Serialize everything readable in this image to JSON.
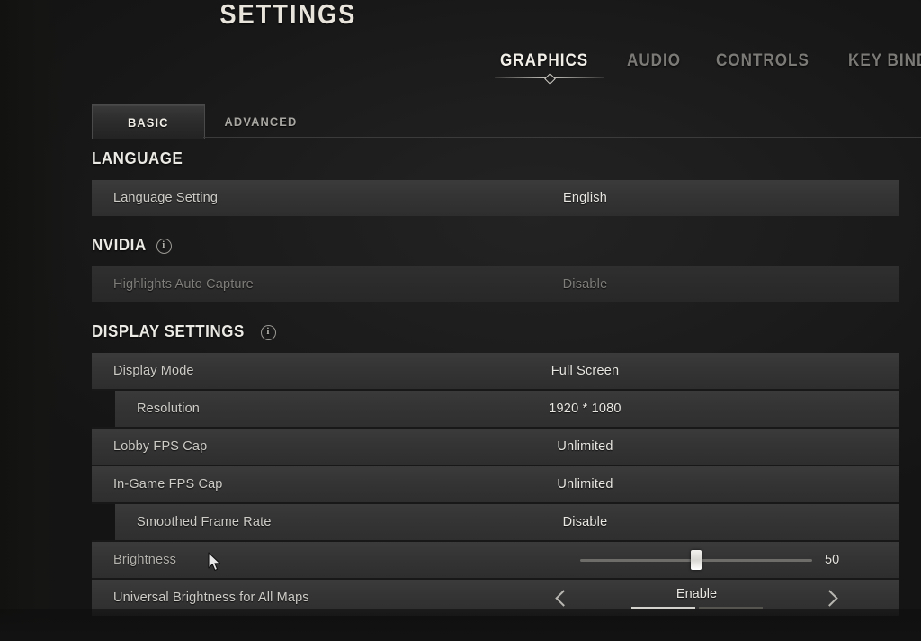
{
  "header": {
    "title": "SETTINGS",
    "tabs": [
      {
        "label": "GRAPHICS",
        "active": true
      },
      {
        "label": "AUDIO",
        "active": false
      },
      {
        "label": "CONTROLS",
        "active": false
      },
      {
        "label": "KEY BINDINGS",
        "active": false
      }
    ]
  },
  "subtabs": [
    {
      "label": "BASIC",
      "active": true
    },
    {
      "label": "ADVANCED",
      "active": false
    }
  ],
  "sections": {
    "language": {
      "title": "LANGUAGE",
      "has_info": false,
      "rows": [
        {
          "label": "Language Setting",
          "value": "English"
        }
      ]
    },
    "nvidia": {
      "title": "NVIDIA",
      "has_info": true,
      "rows": [
        {
          "label": "Highlights Auto Capture",
          "value": "Disable"
        }
      ]
    },
    "display": {
      "title": "DISPLAY SETTINGS",
      "has_info": true,
      "rows": [
        {
          "label": "Display Mode",
          "value": "Full Screen"
        },
        {
          "label": "Resolution",
          "value": "1920 * 1080"
        },
        {
          "label": "Lobby FPS Cap",
          "value": "Unlimited"
        },
        {
          "label": "In-Game FPS Cap",
          "value": "Unlimited"
        },
        {
          "label": "Smoothed Frame Rate",
          "value": "Disable"
        },
        {
          "label": "Brightness",
          "value": "50"
        },
        {
          "label": "Universal Brightness for All Maps",
          "value": "Enable"
        }
      ]
    }
  },
  "controls": {
    "brightness_slider": {
      "value": "50",
      "min": "0",
      "max": "100",
      "percent": 50
    },
    "universal_brightness_stepper": {
      "value": "Enable",
      "prev_icon": "chevron-left-icon",
      "next_icon": "chevron-right-icon",
      "option_count": 2,
      "selected_index": 0
    }
  },
  "icons": {
    "info": "info-icon",
    "cursor": "mouse-cursor"
  },
  "colors": {
    "background": "#1c1c1c",
    "row": "#343434",
    "row_dim": "#2b2b2b",
    "text_bright": "#e9e7e2",
    "text_dim": "#7e7d7a",
    "accent": "#d4d2cc"
  }
}
